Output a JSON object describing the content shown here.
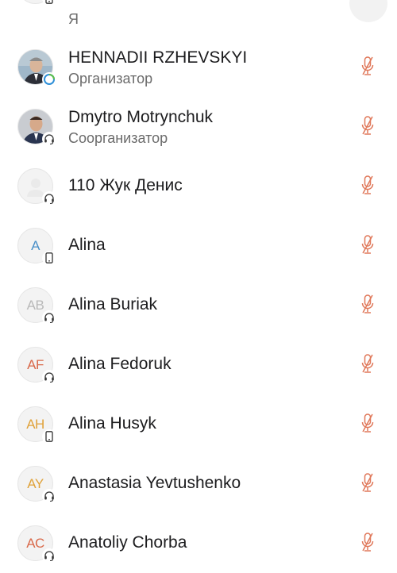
{
  "colors": {
    "mic_muted": "#e0785a"
  },
  "participants": [
    {
      "name": "",
      "role": "Я",
      "avatar": "",
      "avatar_type": "blank",
      "badge": "phone-icon"
    },
    {
      "name": "HENNADII RZHEVSKYI",
      "role": "Организатор",
      "avatar": "",
      "avatar_type": "photo",
      "badge": "org-badge-icon"
    },
    {
      "name": "Dmytro Motrynchuk",
      "role": "Соорганизатор",
      "avatar": "",
      "avatar_type": "photo",
      "badge": "headset-icon"
    },
    {
      "name": "110 Жук Денис",
      "role": "",
      "avatar": "",
      "avatar_type": "blank",
      "badge": "headset-icon"
    },
    {
      "name": "Alina",
      "role": "",
      "avatar": "A",
      "avatar_color": "#4a90c8",
      "badge": "phone-icon"
    },
    {
      "name": "Alina Buriak",
      "role": "",
      "avatar": "AB",
      "avatar_color": "#b9b9b9",
      "badge": "headset-icon"
    },
    {
      "name": "Alina Fedoruk",
      "role": "",
      "avatar": "AF",
      "avatar_color": "#d9694a",
      "badge": "headset-icon"
    },
    {
      "name": "Alina Husyk",
      "role": "",
      "avatar": "AH",
      "avatar_color": "#e0a23a",
      "badge": "phone-icon"
    },
    {
      "name": "Anastasia Yevtushenko",
      "role": "",
      "avatar": "AY",
      "avatar_color": "#e0a23a",
      "badge": "headset-icon"
    },
    {
      "name": "Anatoliy Chorba",
      "role": "",
      "avatar": "AC",
      "avatar_color": "#d9694a",
      "badge": "headset-icon"
    }
  ]
}
